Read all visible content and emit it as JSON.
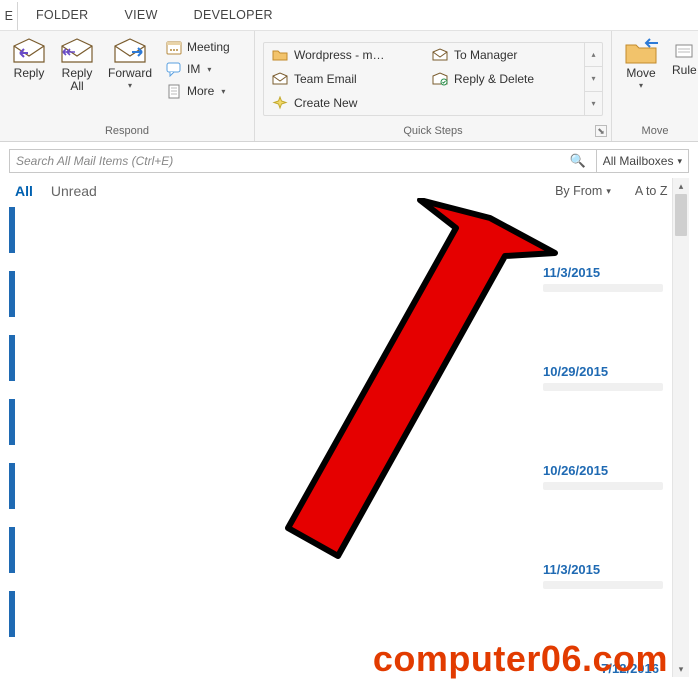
{
  "tabs": {
    "t0": "E",
    "t1": "FOLDER",
    "t2": "VIEW",
    "t3": "DEVELOPER"
  },
  "ribbon": {
    "respond": {
      "label": "Respond",
      "reply": "Reply",
      "replyAll": "Reply\nAll",
      "forward": "Forward",
      "meeting": "Meeting",
      "im": "IM",
      "more": "More"
    },
    "quickSteps": {
      "label": "Quick Steps",
      "items": [
        "Wordpress - m…",
        "To Manager",
        "Team Email",
        "Reply & Delete",
        "Create New"
      ]
    },
    "move": {
      "label": "Move",
      "move": "Move",
      "rules": "Rule"
    }
  },
  "search": {
    "placeholder": "Search All Mail Items (Ctrl+E)",
    "scope": "All Mailboxes"
  },
  "filter": {
    "all": "All",
    "unread": "Unread",
    "sortBy": "By From",
    "sortOrder": "A to Z"
  },
  "messageDates": [
    "11/3/2015",
    "10/29/2015",
    "10/26/2015",
    "11/3/2015",
    "7/12/2016"
  ],
  "watermark": "computer06.com"
}
